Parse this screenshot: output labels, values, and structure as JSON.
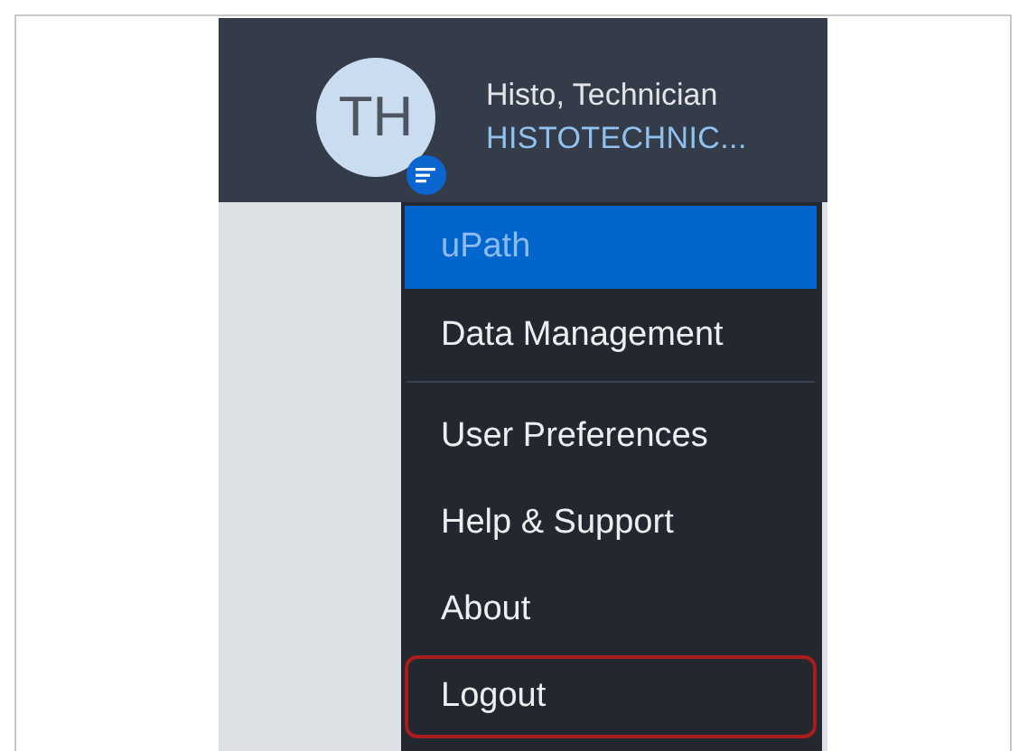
{
  "user": {
    "initials": "TH",
    "name": "Histo, Technician",
    "role": "HISTOTECHNIC..."
  },
  "menu": [
    {
      "label": "uPath",
      "selected": true,
      "outlined": false,
      "divider_after": false
    },
    {
      "label": "Data Management",
      "selected": false,
      "outlined": false,
      "divider_after": true
    },
    {
      "label": "User Preferences",
      "selected": false,
      "outlined": false,
      "divider_after": false
    },
    {
      "label": "Help & Support",
      "selected": false,
      "outlined": false,
      "divider_after": false
    },
    {
      "label": "About",
      "selected": false,
      "outlined": false,
      "divider_after": false
    },
    {
      "label": "Logout",
      "selected": false,
      "outlined": true,
      "divider_after": false
    }
  ]
}
